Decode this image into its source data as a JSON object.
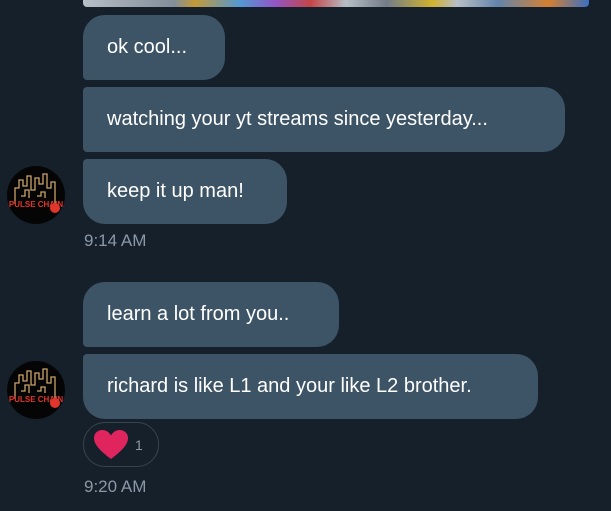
{
  "messages": [
    {
      "text": "ok cool..."
    },
    {
      "text": "watching your yt streams since yesterday..."
    },
    {
      "text": "keep it up man!"
    },
    {
      "text": "learn a lot from you.."
    },
    {
      "text": "richard is like L1 and your like L2 brother."
    }
  ],
  "timestamps": [
    "9:14 AM",
    "9:20 AM"
  ],
  "reaction": {
    "icon": "heart-icon",
    "count": "1",
    "color": "#e0245e"
  },
  "avatar": {
    "text": "PULSE CHAIN",
    "accent": "#c9a36a",
    "red": "#e0352b"
  },
  "colors": {
    "background": "#15202b",
    "bubble": "#3d5466",
    "text": "#ffffff",
    "muted": "#8b98a5"
  }
}
